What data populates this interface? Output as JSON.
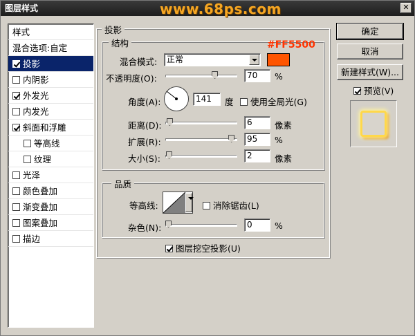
{
  "window": {
    "title": "图层样式",
    "watermark": "www.68ps.com"
  },
  "styles_list": {
    "header": "样式",
    "items": [
      {
        "label": "混合选项:自定",
        "checkbox": false,
        "checked": false,
        "selected": false,
        "sub": false
      },
      {
        "label": "投影",
        "checkbox": true,
        "checked": true,
        "selected": true,
        "sub": false
      },
      {
        "label": "内阴影",
        "checkbox": true,
        "checked": false,
        "selected": false,
        "sub": false
      },
      {
        "label": "外发光",
        "checkbox": true,
        "checked": true,
        "selected": false,
        "sub": false
      },
      {
        "label": "内发光",
        "checkbox": true,
        "checked": false,
        "selected": false,
        "sub": false
      },
      {
        "label": "斜面和浮雕",
        "checkbox": true,
        "checked": true,
        "selected": false,
        "sub": false
      },
      {
        "label": "等高线",
        "checkbox": true,
        "checked": false,
        "selected": false,
        "sub": true
      },
      {
        "label": "纹理",
        "checkbox": true,
        "checked": false,
        "selected": false,
        "sub": true
      },
      {
        "label": "光泽",
        "checkbox": true,
        "checked": false,
        "selected": false,
        "sub": false
      },
      {
        "label": "颜色叠加",
        "checkbox": true,
        "checked": false,
        "selected": false,
        "sub": false
      },
      {
        "label": "渐变叠加",
        "checkbox": true,
        "checked": false,
        "selected": false,
        "sub": false
      },
      {
        "label": "图案叠加",
        "checkbox": true,
        "checked": false,
        "selected": false,
        "sub": false
      },
      {
        "label": "描边",
        "checkbox": true,
        "checked": false,
        "selected": false,
        "sub": false
      }
    ]
  },
  "drop_shadow": {
    "section_title": "投影",
    "structure": {
      "title": "结构",
      "blend_mode_label": "混合模式:",
      "blend_mode_value": "正常",
      "color": "#FF5500",
      "color_label": "#FF5500",
      "opacity_label": "不透明度(O):",
      "opacity_value": "70",
      "opacity_unit": "%",
      "opacity_fraction": 0.7,
      "angle_label": "角度(A):",
      "angle_value": "141",
      "angle_unit": "度",
      "global_light_label": "使用全局光(G)",
      "global_light_checked": false,
      "distance_label": "距离(D):",
      "distance_value": "6",
      "distance_unit": "像素",
      "distance_fraction": 0.02,
      "spread_label": "扩展(R):",
      "spread_value": "95",
      "spread_unit": "%",
      "spread_fraction": 0.95,
      "size_label": "大小(S):",
      "size_value": "2",
      "size_unit": "像素",
      "size_fraction": 0.01
    },
    "quality": {
      "title": "品质",
      "contour_label": "等高线:",
      "anti_alias_label": "消除锯齿(L)",
      "anti_alias_checked": false,
      "noise_label": "杂色(N):",
      "noise_value": "0",
      "noise_unit": "%",
      "noise_fraction": 0.0
    },
    "knockout_label": "图层挖空投影(U)",
    "knockout_checked": true
  },
  "buttons": {
    "ok": "确定",
    "cancel": "取消",
    "new_style": "新建样式(W)...",
    "preview_label": "预览(V)",
    "preview_checked": true
  }
}
